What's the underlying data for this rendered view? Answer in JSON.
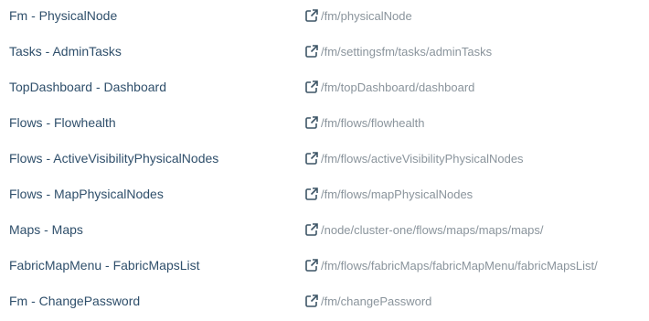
{
  "routes": [
    {
      "name": "Fm - PhysicalNode",
      "path": "/fm/physicalNode",
      "icon": "external-link-icon"
    },
    {
      "name": "Tasks - AdminTasks",
      "path": "/fm/settingsfm/tasks/adminTasks",
      "icon": "external-link-icon"
    },
    {
      "name": "TopDashboard - Dashboard",
      "path": "/fm/topDashboard/dashboard",
      "icon": "external-link-icon"
    },
    {
      "name": "Flows - Flowhealth",
      "path": "/fm/flows/flowhealth",
      "icon": "external-link-icon"
    },
    {
      "name": "Flows - ActiveVisibilityPhysicalNodes",
      "path": "/fm/flows/activeVisibilityPhysicalNodes",
      "icon": "external-link-icon"
    },
    {
      "name": "Flows - MapPhysicalNodes",
      "path": "/fm/flows/mapPhysicalNodes",
      "icon": "external-link-icon"
    },
    {
      "name": "Maps - Maps",
      "path": "/node/cluster-one/flows/maps/maps/maps/",
      "icon": "external-link-icon"
    },
    {
      "name": "FabricMapMenu - FabricMapsList",
      "path": "/fm/flows/fabricMaps/fabricMapMenu/fabricMapsList/",
      "icon": "external-link-icon"
    },
    {
      "name": "Fm - ChangePassword",
      "path": "/fm/changePassword",
      "icon": "external-link-icon"
    }
  ],
  "colors": {
    "name_text": "#2f4f6b",
    "link_text": "#8a949c",
    "icon": "#3d5566"
  }
}
